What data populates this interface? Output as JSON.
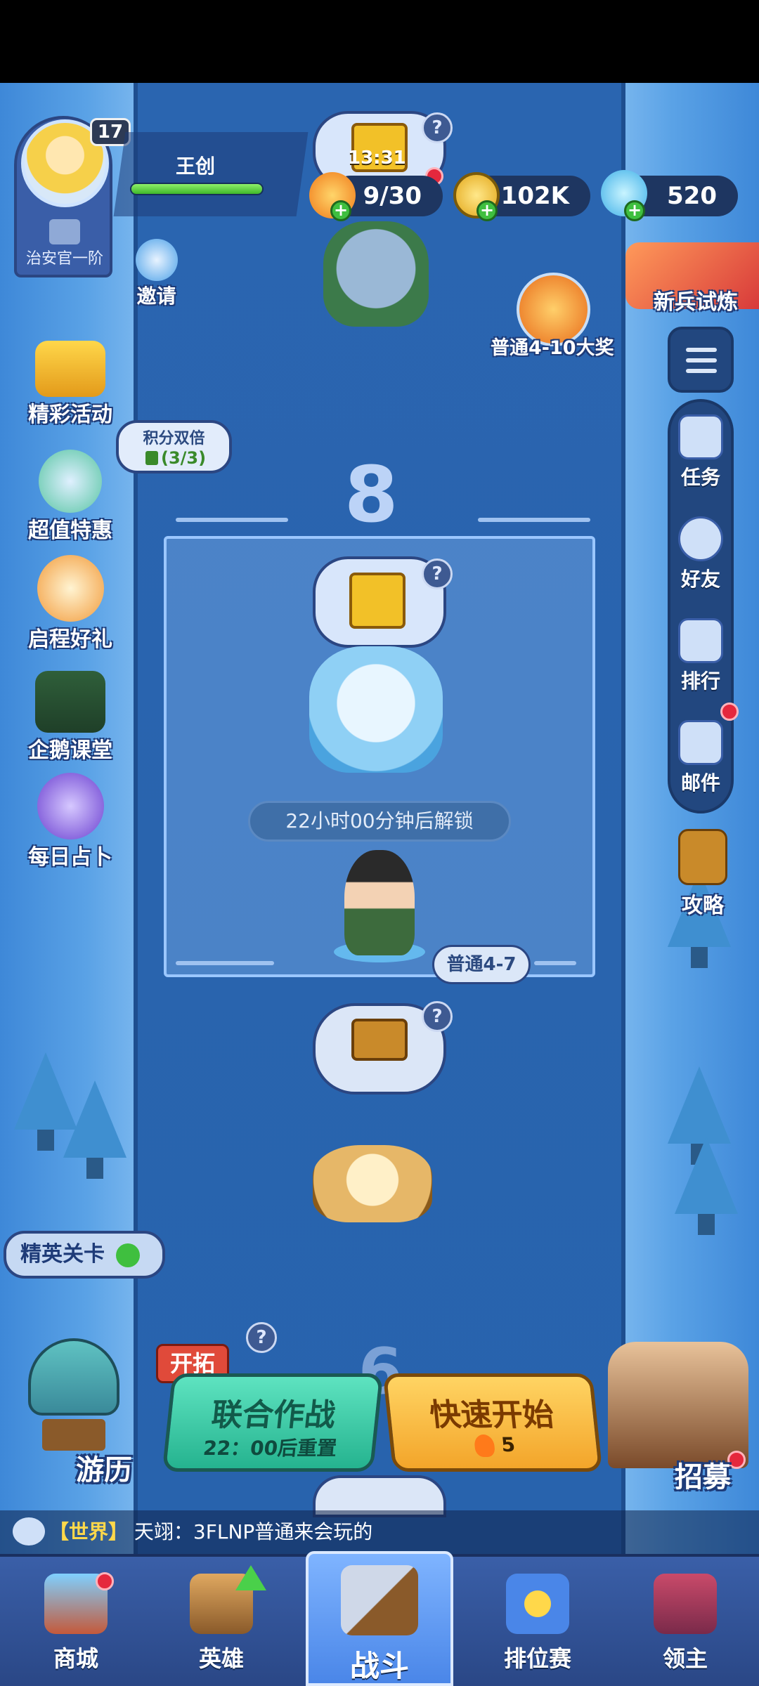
{
  "player": {
    "level": "17",
    "name": "王创",
    "rank": "治安官一阶",
    "hp_fraction": 1.0
  },
  "resources": {
    "stamina": "9/30",
    "coins": "102K",
    "gems": "520",
    "timer": "13:31"
  },
  "invite": {
    "label": "邀请"
  },
  "recruit_trial": {
    "label": "新兵试炼"
  },
  "stage_reward": {
    "label": "普通4-10大奖"
  },
  "left_menu": [
    {
      "name": "event",
      "label": "精彩活动"
    },
    {
      "name": "deal",
      "label": "超值特惠"
    },
    {
      "name": "gift",
      "label": "启程好礼"
    },
    {
      "name": "class",
      "label": "企鹅课堂"
    },
    {
      "name": "fortune",
      "label": "每日占卜"
    }
  ],
  "double_points": {
    "title": "积分双倍",
    "count": "(3/3)"
  },
  "right_menu": [
    {
      "name": "tasks",
      "label": "任务"
    },
    {
      "name": "friends",
      "label": "好友"
    },
    {
      "name": "ranking",
      "label": "排行"
    },
    {
      "name": "mail",
      "label": "邮件"
    }
  ],
  "guide": {
    "label": "攻略"
  },
  "stage": {
    "number": "8",
    "unlock_text": "22小时00分钟后解锁",
    "current_tag": "普通4-7",
    "next_number": "6"
  },
  "elite": {
    "label": "精英关卡"
  },
  "explore": {
    "tag": "开拓",
    "label": "游历"
  },
  "coop": {
    "title": "联合作战",
    "sub": "22：00后重置"
  },
  "quick": {
    "title": "快速开始",
    "cost": "5"
  },
  "recruit": {
    "label": "招募"
  },
  "chat": {
    "channel": "【世界】",
    "message": "天翊：3FLNP普通来会玩的"
  },
  "nav": [
    {
      "name": "shop",
      "label": "商城"
    },
    {
      "name": "heroes",
      "label": "英雄"
    },
    {
      "name": "battle",
      "label": "战斗"
    },
    {
      "name": "ranked",
      "label": "排位赛"
    },
    {
      "name": "lord",
      "label": "领主"
    }
  ],
  "help_mark": "?",
  "plus_mark": "+",
  "colors": {
    "accent_green": "#3fb82a",
    "coop_btn": "#25b38f",
    "quick_btn": "#f3a52a",
    "alert_red": "#e5283d"
  }
}
